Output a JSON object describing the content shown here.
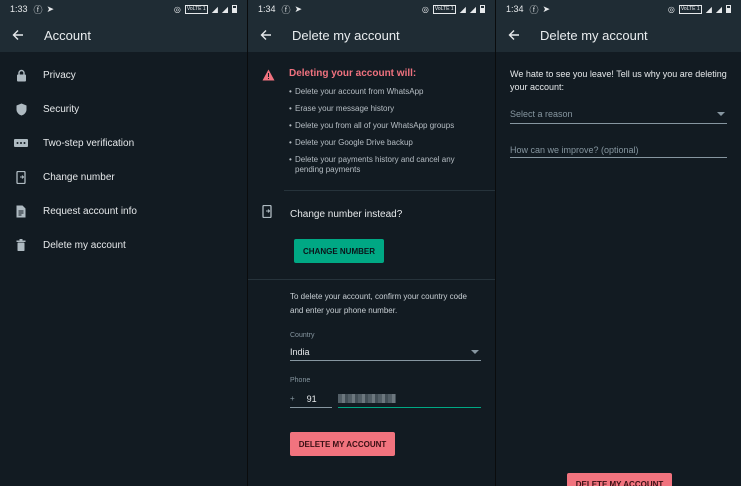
{
  "panel1": {
    "status": {
      "time": "1:33",
      "volte": "VoLTE 1"
    },
    "title": "Account",
    "items": [
      {
        "label": "Privacy",
        "icon": "lock-icon"
      },
      {
        "label": "Security",
        "icon": "shield-icon"
      },
      {
        "label": "Two-step verification",
        "icon": "dots-icon"
      },
      {
        "label": "Change number",
        "icon": "phone-change-icon"
      },
      {
        "label": "Request account info",
        "icon": "document-icon"
      },
      {
        "label": "Delete my account",
        "icon": "trash-icon"
      }
    ]
  },
  "panel2": {
    "status": {
      "time": "1:34",
      "volte": "VoLTE 1"
    },
    "title": "Delete my account",
    "warning_title": "Deleting your account will:",
    "bullets": [
      "Delete your account from WhatsApp",
      "Erase your message history",
      "Delete you from all of your WhatsApp groups",
      "Delete your Google Drive backup",
      "Delete your payments history and cancel any pending payments"
    ],
    "change_number_text": "Change number instead?",
    "change_number_button": "CHANGE NUMBER",
    "form_intro": "To delete your account, confirm your country code and enter your phone number.",
    "country_label": "Country",
    "country_value": "India",
    "phone_label": "Phone",
    "phone_plus": "+",
    "phone_code": "91",
    "delete_button": "DELETE MY ACCOUNT"
  },
  "panel3": {
    "status": {
      "time": "1:34",
      "volte": "VoLTE 1"
    },
    "title": "Delete my account",
    "intro": "We hate to see you leave! Tell us why you are deleting your account:",
    "reason_placeholder": "Select a reason",
    "improve_placeholder": "How can we improve? (optional)",
    "delete_button": "DELETE MY ACCOUNT"
  },
  "colors": {
    "teal": "#00a884",
    "red": "#f1737e",
    "warning": "#f0727f",
    "bg": "#121b22",
    "bar": "#1f2c34"
  }
}
